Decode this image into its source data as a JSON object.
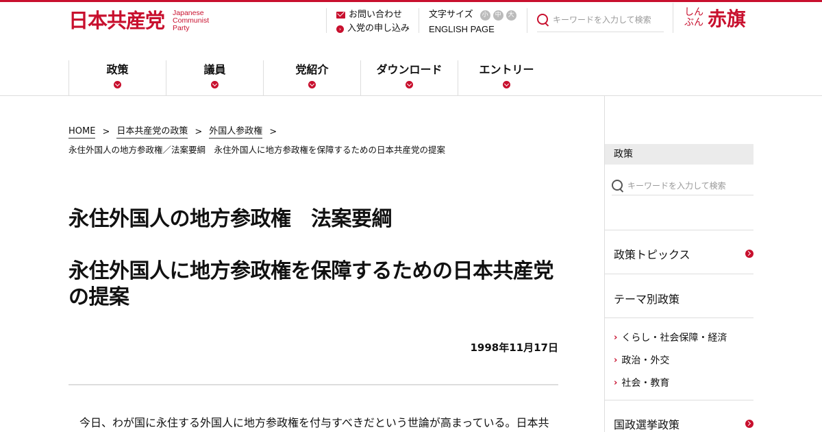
{
  "header": {
    "logo_main": "日本共産党",
    "logo_sub": [
      "Japanese",
      "Communist",
      "Party"
    ],
    "contact_label": "お問い合わせ",
    "join_label": "入党の申し込み",
    "font_size_label": "文字サイズ",
    "font_sizes": [
      "小",
      "中",
      "大"
    ],
    "english_label": "ENGLISH PAGE",
    "search_placeholder": "キーワードを入力して検索",
    "akahata_kana": "しんぶん",
    "akahata_main": "赤旗"
  },
  "nav": {
    "items": [
      "政策",
      "議員",
      "党紹介",
      "ダウンロード",
      "エントリー"
    ]
  },
  "breadcrumb": {
    "items": [
      "HOME",
      "日本共産党の政策",
      "外国人参政権"
    ],
    "separator": ">",
    "current": "永住外国人の地方参政権／法案要綱　永住外国人に地方参政権を保障するための日本共産党の提案"
  },
  "article": {
    "title1": "永住外国人の地方参政権　法案要綱",
    "title2": "永住外国人に地方参政権を保障するための日本共産党の提案",
    "date": "1998年11月17日",
    "body_start": "今日、わが国に永住する外国人に地方参政権を付与すべきだという世論が高まっている。日本共"
  },
  "sidebar": {
    "heading": "政策",
    "search_placeholder": "キーワードを入力して検索",
    "items": [
      "政策トピックス",
      "テーマ別政策"
    ],
    "sub_items": [
      "くらし・社会保障・経済",
      "政治・外交",
      "社会・教育"
    ],
    "bottom_item": "国政選挙政策"
  },
  "colors": {
    "accent": "#c8102e",
    "divider": "#dddddd",
    "sidebar_head_bg": "#ebebeb"
  }
}
